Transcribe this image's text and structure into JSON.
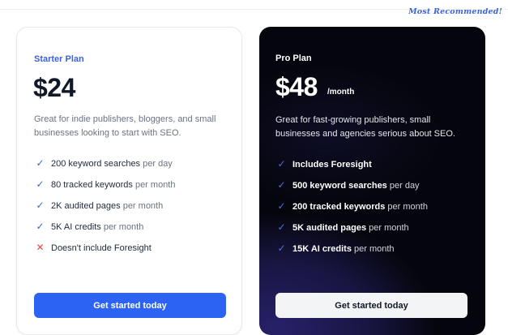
{
  "banner": {
    "recommended_label": "Most Recommended!"
  },
  "plans": {
    "starter": {
      "name": "Starter Plan",
      "price": "$24",
      "description": "Great for indie publishers, bloggers, and small businesses looking to start with SEO.",
      "cta": "Get started today",
      "features": [
        {
          "icon": "check-icon",
          "strong": "200 keyword searches",
          "light": " per day"
        },
        {
          "icon": "check-icon",
          "strong": "80 tracked keywords",
          "light": " per month"
        },
        {
          "icon": "check-icon",
          "strong": "2K audited pages",
          "light": " per month"
        },
        {
          "icon": "check-icon",
          "strong": "5K AI credits",
          "light": " per month"
        },
        {
          "icon": "cross-icon",
          "strong": "Doesn't include Foresight",
          "light": ""
        }
      ]
    },
    "pro": {
      "name": "Pro Plan",
      "price": "$48",
      "period": "/month",
      "description": "Great for fast-growing publishers, small businesses and agencies serious about SEO.",
      "cta": "Get started today",
      "features": [
        {
          "icon": "check-icon",
          "strong": "Includes Foresight",
          "light": ""
        },
        {
          "icon": "check-icon",
          "strong": "500 keyword searches",
          "light": " per day"
        },
        {
          "icon": "check-icon",
          "strong": "200 tracked keywords",
          "light": " per month"
        },
        {
          "icon": "check-icon",
          "strong": "5K audited pages",
          "light": " per month"
        },
        {
          "icon": "check-icon",
          "strong": "15K AI credits",
          "light": " per month"
        }
      ]
    }
  },
  "colors": {
    "accent_blue": "#2d63f2",
    "pro_background": "#05060d",
    "cross_red": "#e04848"
  }
}
